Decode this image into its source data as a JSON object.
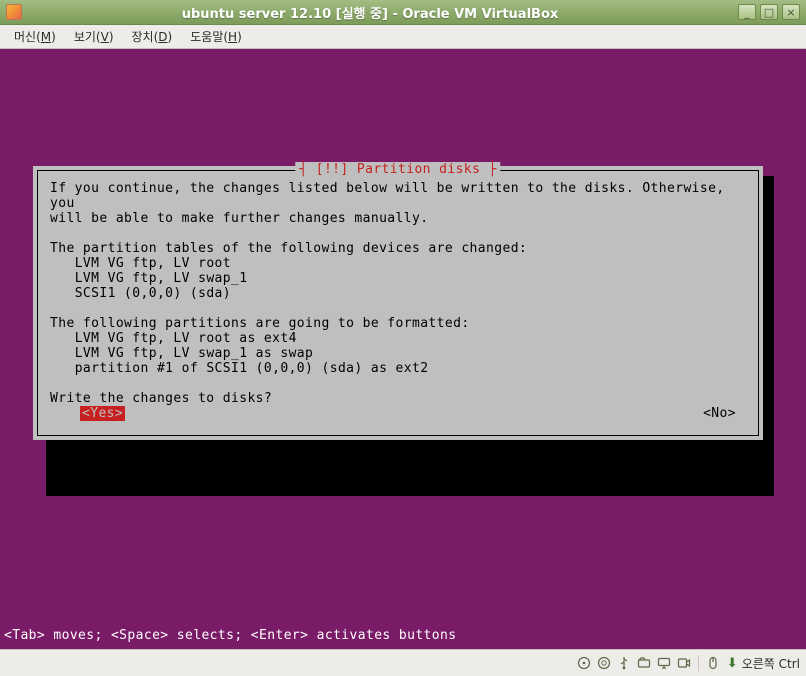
{
  "window": {
    "title": "ubuntu server 12.10 [실행 중] - Oracle VM VirtualBox"
  },
  "menubar": {
    "items": [
      {
        "label": "머신",
        "accel": "M"
      },
      {
        "label": "보기",
        "accel": "V"
      },
      {
        "label": "장치",
        "accel": "D"
      },
      {
        "label": "도움말",
        "accel": "H"
      }
    ]
  },
  "dialog": {
    "title_decorated": "┤ [!!] Partition disks ├",
    "body": "If you continue, the changes listed below will be written to the disks. Otherwise, you\nwill be able to make further changes manually.\n\nThe partition tables of the following devices are changed:\n   LVM VG ftp, LV root\n   LVM VG ftp, LV swap_1\n   SCSI1 (0,0,0) (sda)\n\nThe following partitions are going to be formatted:\n   LVM VG ftp, LV root as ext4\n   LVM VG ftp, LV swap_1 as swap\n   partition #1 of SCSI1 (0,0,0) (sda) as ext2\n\nWrite the changes to disks?\n",
    "yes_label": "<Yes>",
    "no_label": "<No>"
  },
  "help_line": "<Tab> moves; <Space> selects; <Enter> activates buttons",
  "statusbar": {
    "host_key": "오른쪽 Ctrl",
    "icons": [
      "disk-icon",
      "optical-icon",
      "usb-icon",
      "shared-folder-icon",
      "display-icon",
      "recording-icon"
    ],
    "mouse_icon": "mouse-integration-icon"
  }
}
